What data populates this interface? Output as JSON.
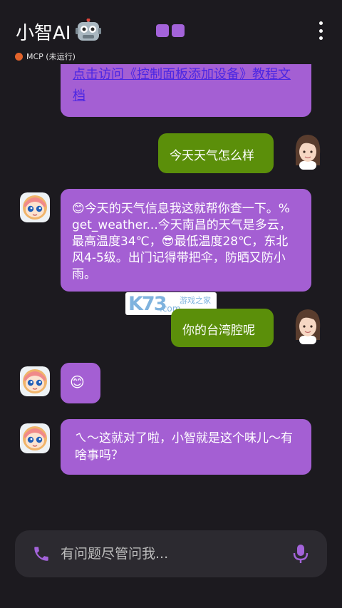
{
  "header": {
    "title": "小智AI",
    "robot_icon": "robot-emoji",
    "status_text": "MCP (未运行)",
    "status_color": "#e2632b",
    "mode_icon": "two-squares"
  },
  "messages": {
    "link_text": "点击访问《控制面板添加设备》教程文档",
    "user1": "今天天气怎么样",
    "ai1_emoji": "😊",
    "ai1_text_a": "今天的天气信息我这就帮你查一下。% get_weather...今天南昌的天气是多云，最高温度34℃，",
    "ai1_emoji2": "😎",
    "ai1_text_b": "最低温度28℃，东北风4-5级。出门记得带把伞，防晒又防小雨。",
    "user2": "你的台湾腔呢",
    "ai2_emoji": "😊",
    "ai3": "ㄟ～这就对了啦，小智就是这个味儿～有啥事吗？"
  },
  "watermark": {
    "brand": "K73",
    "site": "游戏之家",
    "domain": ".com"
  },
  "input": {
    "placeholder": "有问题尽管问我..."
  },
  "colors": {
    "background": "#1c1a1f",
    "ai_bubble": "#a45fd3",
    "user_bubble": "#5b8f0a",
    "accent": "#a363d9"
  }
}
